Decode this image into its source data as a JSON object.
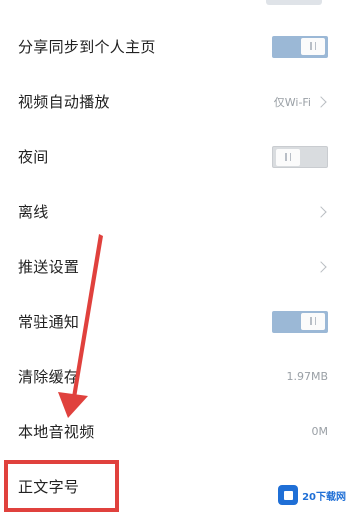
{
  "settings": {
    "items": [
      {
        "label": "分享同步到个人主页",
        "control": "toggle",
        "toggle_on": true
      },
      {
        "label": "视频自动播放",
        "control": "value-chevron",
        "value": "仅Wi-Fi"
      },
      {
        "label": "夜间",
        "control": "toggle",
        "toggle_on": false
      },
      {
        "label": "离线",
        "control": "chevron"
      },
      {
        "label": "推送设置",
        "control": "chevron"
      },
      {
        "label": "常驻通知",
        "control": "toggle",
        "toggle_on": true
      },
      {
        "label": "清除缓存",
        "control": "value",
        "value": "1.97MB"
      },
      {
        "label": "本地音视频",
        "control": "value",
        "value": "0M"
      },
      {
        "label": "正文字号",
        "control": "none"
      }
    ]
  },
  "annotation": {
    "color": "#e0413d"
  },
  "watermark": {
    "text": "20下载网",
    "color": "#1f6fd6"
  },
  "colors": {
    "toggle_on": "#9bb8d6",
    "toggle_off": "#d9dcdf"
  }
}
